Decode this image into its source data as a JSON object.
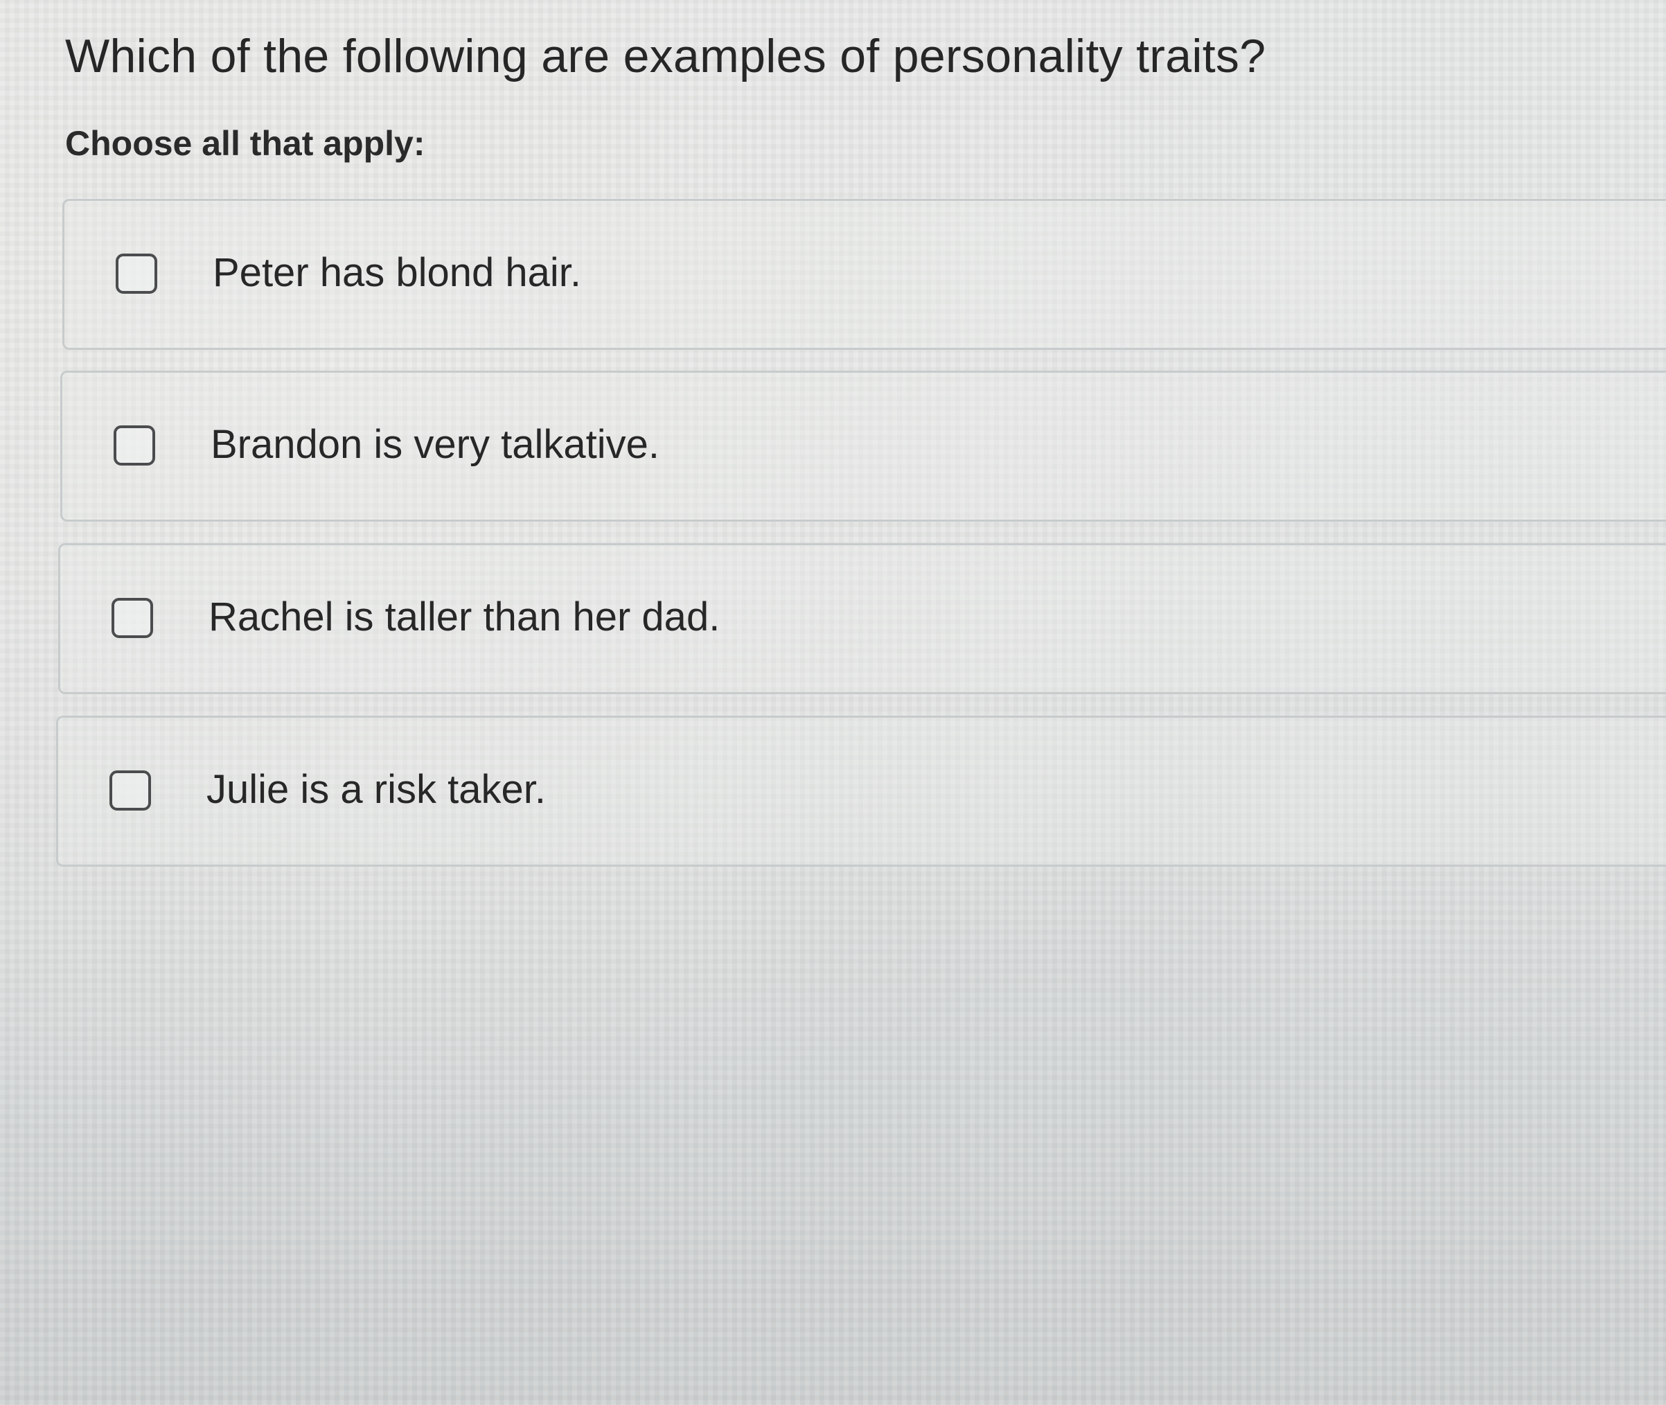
{
  "question": {
    "text": "Which of the following are examples of personality traits?",
    "instruction": "Choose all that apply:"
  },
  "options": [
    {
      "label": "Peter has blond hair.",
      "checked": false
    },
    {
      "label": "Brandon is very talkative.",
      "checked": false
    },
    {
      "label": "Rachel is taller than her dad.",
      "checked": false
    },
    {
      "label": "Julie is a risk taker.",
      "checked": false
    }
  ],
  "colors": {
    "text": "#262626",
    "border": "#c7cbcc",
    "checkbox_border": "#4a4c4e"
  }
}
